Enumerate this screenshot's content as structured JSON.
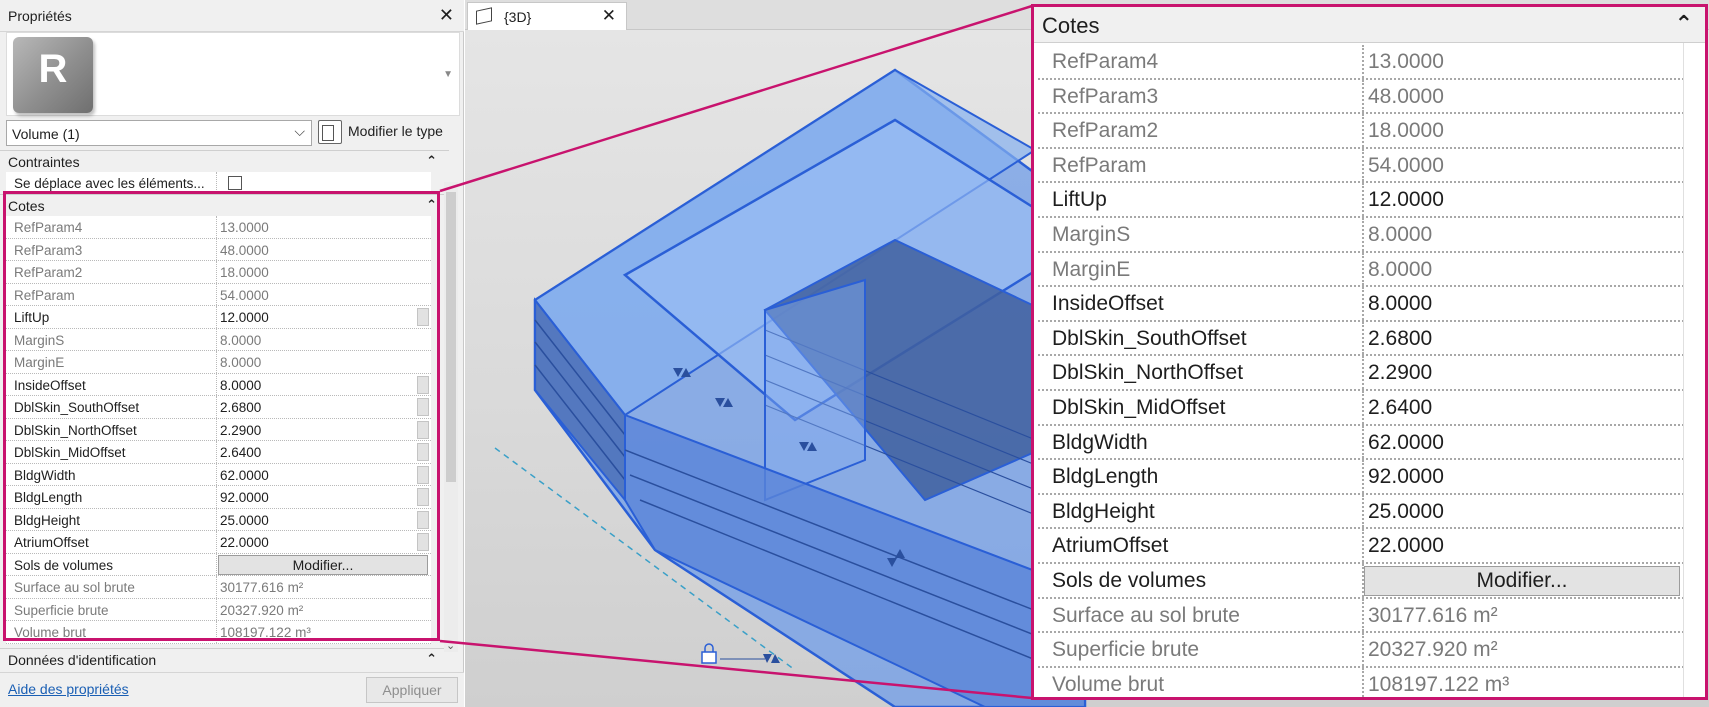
{
  "properties": {
    "title": "Propriétés",
    "type_logo_letter": "R",
    "type_selector_value": "Volume (1)",
    "edit_type_label": "Modifier le type",
    "sections": {
      "constraints": "Contraintes",
      "dimensions": "Cotes",
      "identity": "Données d'identification"
    },
    "constraint_rows": [
      {
        "name": "Se déplace avec les éléments...",
        "checked": false
      }
    ],
    "rows": [
      {
        "name": "RefParam4",
        "value": "13.0000",
        "dim": true
      },
      {
        "name": "RefParam3",
        "value": "48.0000",
        "dim": true
      },
      {
        "name": "RefParam2",
        "value": "18.0000",
        "dim": true
      },
      {
        "name": "RefParam",
        "value": "54.0000",
        "dim": true
      },
      {
        "name": "LiftUp",
        "value": "12.0000",
        "dim": false
      },
      {
        "name": "MarginS",
        "value": "8.0000",
        "dim": true
      },
      {
        "name": "MarginE",
        "value": "8.0000",
        "dim": true
      },
      {
        "name": "InsideOffset",
        "value": "8.0000",
        "dim": false
      },
      {
        "name": "DblSkin_SouthOffset",
        "value": "2.6800",
        "dim": false
      },
      {
        "name": "DblSkin_NorthOffset",
        "value": "2.2900",
        "dim": false
      },
      {
        "name": "DblSkin_MidOffset",
        "value": "2.6400",
        "dim": false
      },
      {
        "name": "BldgWidth",
        "value": "62.0000",
        "dim": false
      },
      {
        "name": "BldgLength",
        "value": "92.0000",
        "dim": false
      },
      {
        "name": "BldgHeight",
        "value": "25.0000",
        "dim": false
      },
      {
        "name": "AtriumOffset",
        "value": "22.0000",
        "dim": false
      },
      {
        "name": "Sols de volumes",
        "value": "Modifier...",
        "dim": false,
        "button": true
      },
      {
        "name": "Surface au sol brute",
        "value": "30177.616 m²",
        "dim": true
      },
      {
        "name": "Superficie brute",
        "value": "20327.920 m²",
        "dim": true
      },
      {
        "name": "Volume brut",
        "value": "108197.122 m³",
        "dim": true
      }
    ],
    "help_link": "Aide des propriétés",
    "apply_button": "Appliquer"
  },
  "view": {
    "tab_label": "{3D}"
  },
  "colors": {
    "highlight": "#c8136e",
    "link": "#1a5fb4",
    "mass_fill": "#5b8ee6",
    "mass_edge": "#2a5fd6"
  }
}
